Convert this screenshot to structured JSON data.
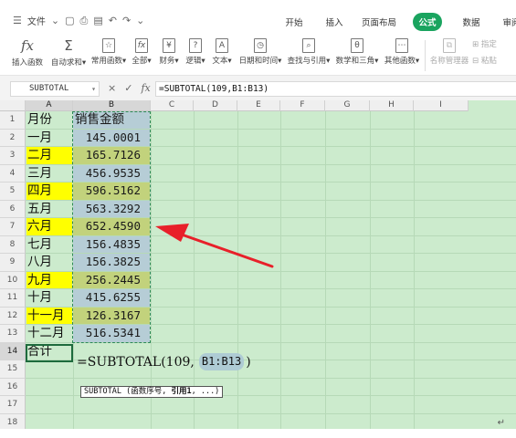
{
  "menubar": {
    "file_label": "文件",
    "tabs": [
      "开始",
      "插入",
      "页面布局",
      "公式",
      "数据",
      "审阅"
    ],
    "active_tab": "公式"
  },
  "ribbon": {
    "items": [
      {
        "label": "插入函数",
        "glyph": "fx"
      },
      {
        "label": "自动求和▾",
        "glyph": "Σ"
      },
      {
        "label": "常用函数▾",
        "glyph": "☆"
      },
      {
        "label": "全部▾",
        "glyph": "fx"
      },
      {
        "label": "财务▾",
        "glyph": "¥"
      },
      {
        "label": "逻辑▾",
        "glyph": "?"
      },
      {
        "label": "文本▾",
        "glyph": "A"
      },
      {
        "label": "日期和时间▾",
        "glyph": "◷"
      },
      {
        "label": "查找与引用▾",
        "glyph": "⌕"
      },
      {
        "label": "数学和三角▾",
        "glyph": "θ"
      },
      {
        "label": "其他函数▾",
        "glyph": "⋯"
      },
      {
        "label": "名称管理器",
        "glyph": "⧉"
      },
      {
        "label": "指定",
        "glyph": "⊞"
      },
      {
        "label": "粘贴",
        "glyph": "⊟"
      }
    ]
  },
  "formula_bar": {
    "name_box": "SUBTOTAL",
    "cancel_icon": "×",
    "confirm_icon": "✓",
    "fx_label": "fx",
    "formula": "=SUBTOTAL(109,B1:B13)"
  },
  "sheet": {
    "columns": [
      "A",
      "B",
      "C",
      "D",
      "E",
      "F",
      "G",
      "H",
      "I"
    ],
    "row_numbers": [
      "1",
      "2",
      "3",
      "4",
      "5",
      "6",
      "7",
      "8",
      "9",
      "10",
      "11",
      "12",
      "13",
      "14",
      "15",
      "16",
      "17",
      "18"
    ],
    "rows": [
      {
        "a": "月份",
        "b": "销售金额",
        "a_yellow": false,
        "b_olive": false
      },
      {
        "a": "一月",
        "b": "145.0001",
        "a_yellow": false,
        "b_olive": false
      },
      {
        "a": "二月",
        "b": "165.7126",
        "a_yellow": true,
        "b_olive": true
      },
      {
        "a": "三月",
        "b": "456.9535",
        "a_yellow": false,
        "b_olive": false
      },
      {
        "a": "四月",
        "b": "596.5162",
        "a_yellow": true,
        "b_olive": true
      },
      {
        "a": "五月",
        "b": "563.3292",
        "a_yellow": false,
        "b_olive": false
      },
      {
        "a": "六月",
        "b": "652.4590",
        "a_yellow": true,
        "b_olive": true
      },
      {
        "a": "七月",
        "b": "156.4835",
        "a_yellow": false,
        "b_olive": false
      },
      {
        "a": "八月",
        "b": "156.3825",
        "a_yellow": false,
        "b_olive": false
      },
      {
        "a": "九月",
        "b": "256.2445",
        "a_yellow": true,
        "b_olive": true
      },
      {
        "a": "十月",
        "b": "415.6255",
        "a_yellow": false,
        "b_olive": false
      },
      {
        "a": "十一月",
        "b": "126.3167",
        "a_yellow": true,
        "b_olive": true
      },
      {
        "a": "十二月",
        "b": "516.5341",
        "a_yellow": false,
        "b_olive": false
      }
    ],
    "total_label": "合计",
    "editing_formula": {
      "prefix": "=SUBTOTAL(109,",
      "reference": "B1:B13",
      "suffix": ")"
    },
    "tooltip": {
      "func": "SUBTOTAL",
      "open": " (",
      "arg1": "函数序号",
      "sep": ", ",
      "arg2": "引用1",
      "rest": ", ...)"
    }
  },
  "colors": {
    "accent": "#1aa45f",
    "sheet_bg": "#ccebcd",
    "highlight_yellow": "#ffff00",
    "value_blue": "#b6cdd6",
    "value_olive": "#c2d27c",
    "arrow_red": "#e8202a"
  },
  "paragraph_mark": "↵"
}
